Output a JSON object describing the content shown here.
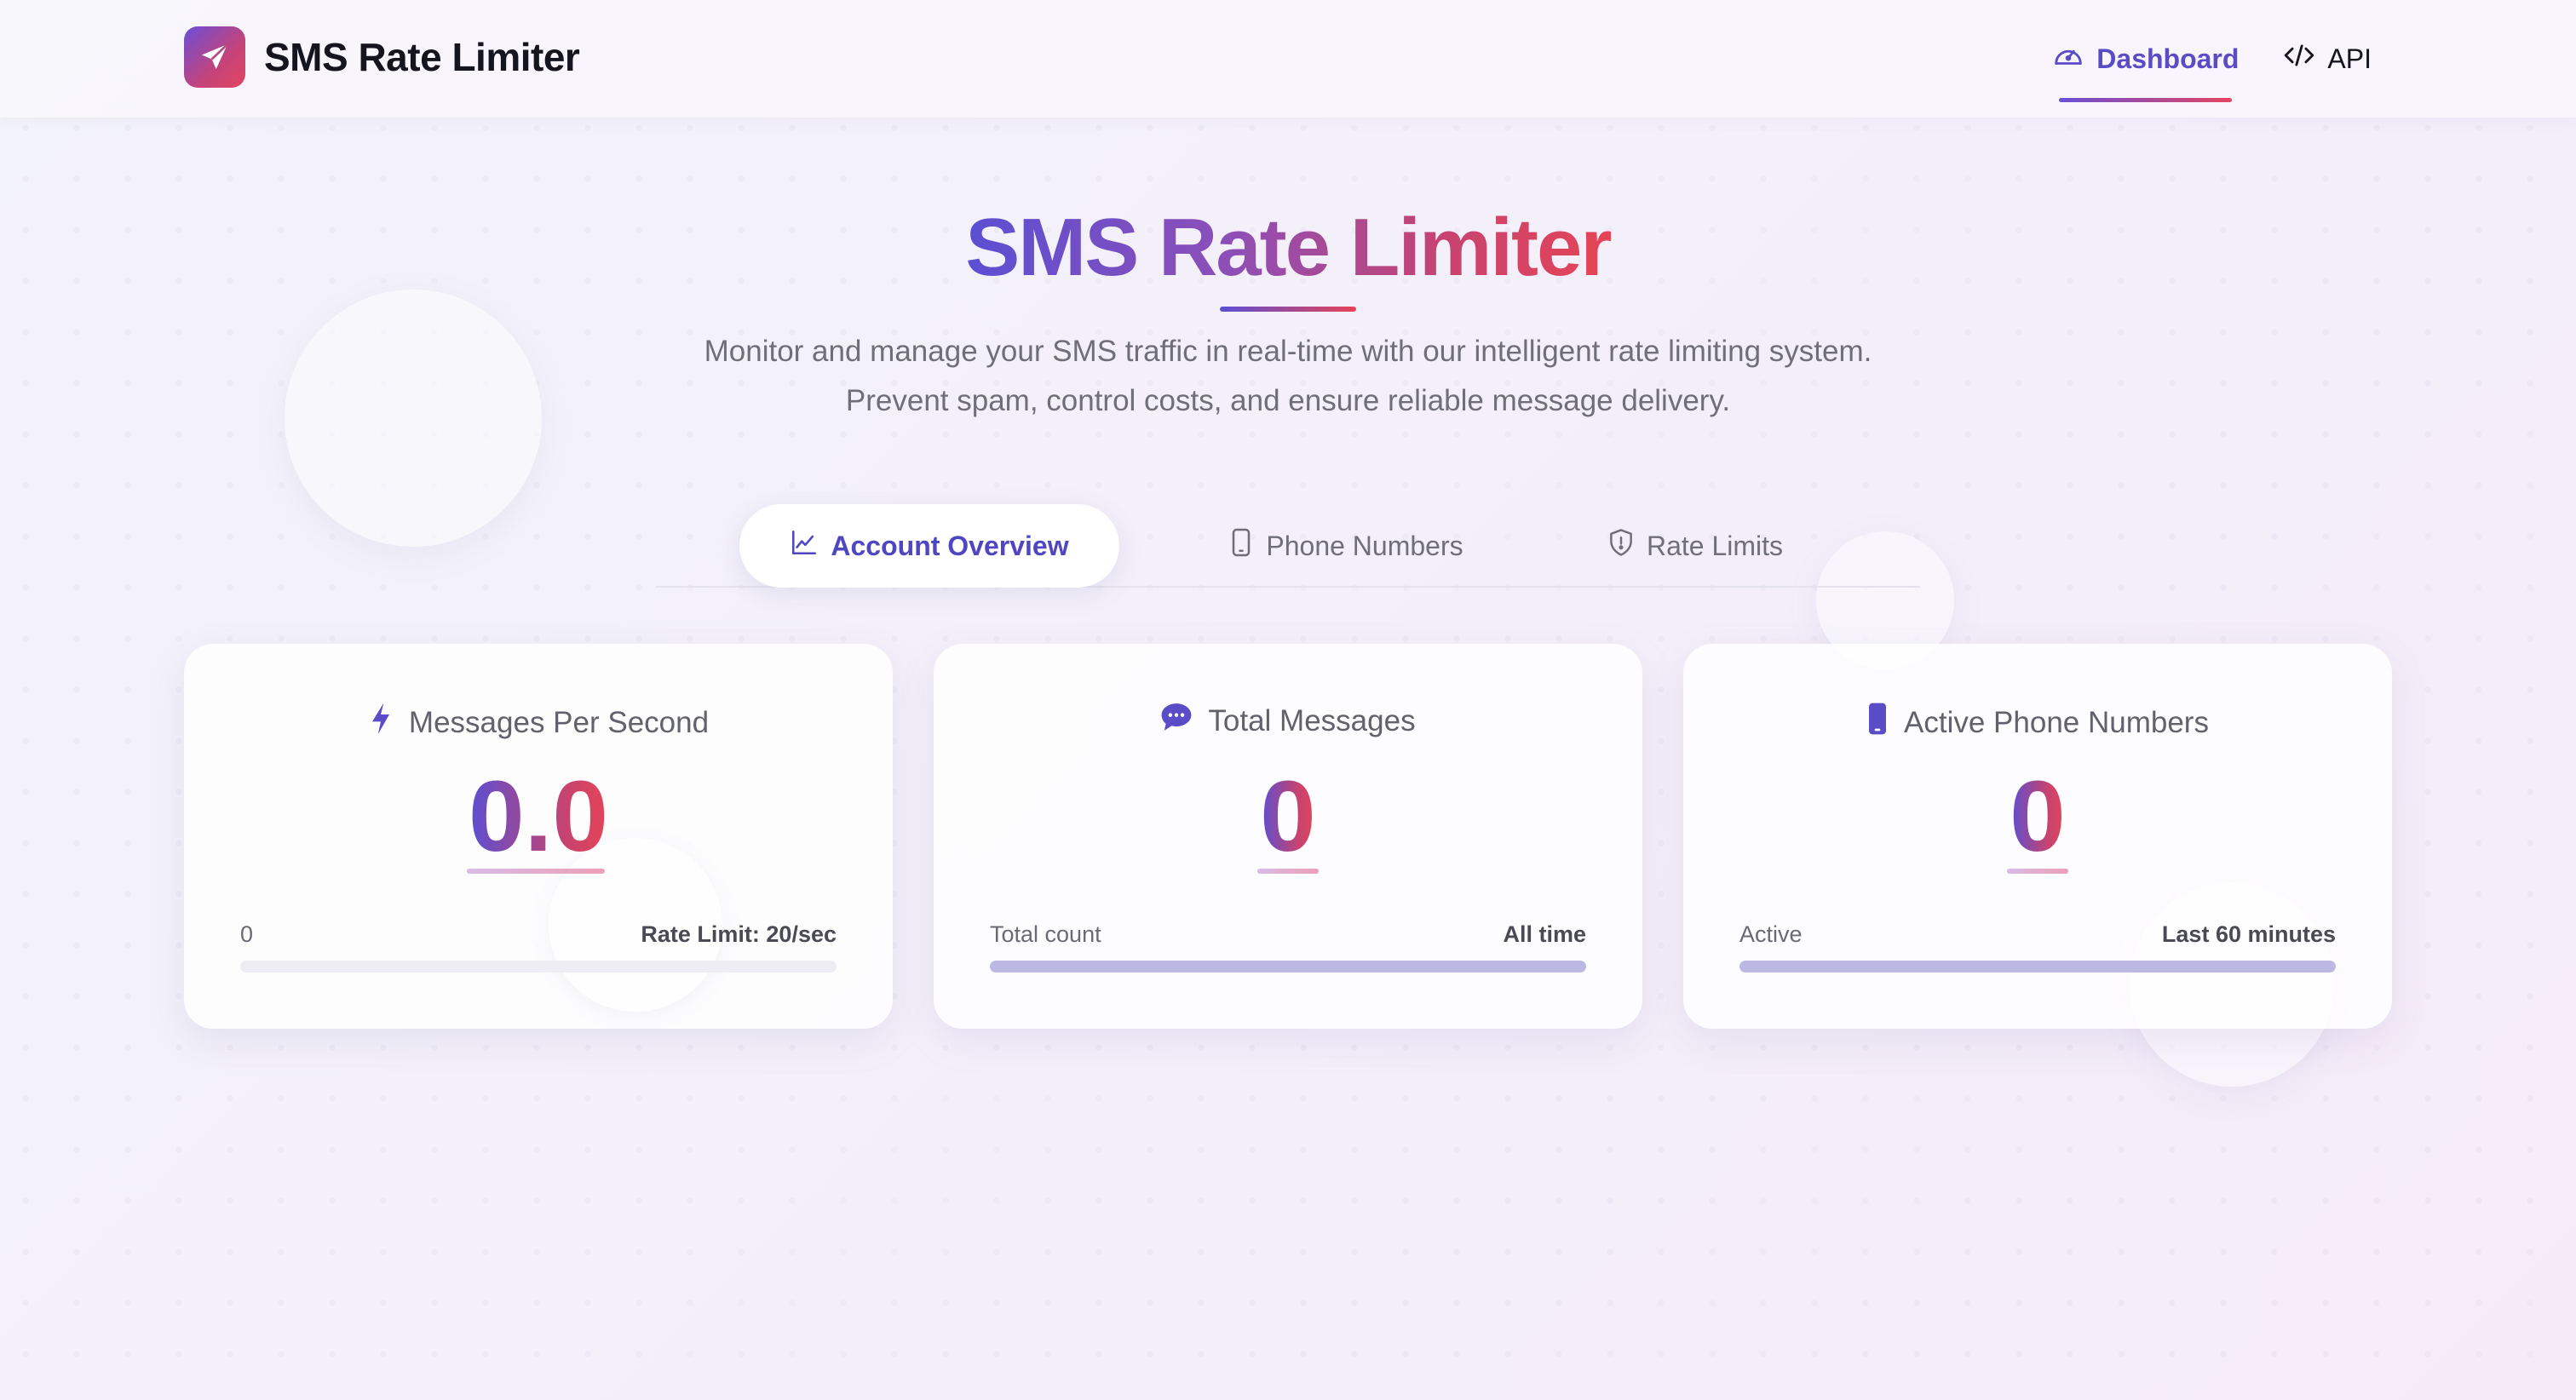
{
  "app": {
    "brand_name": "SMS Rate Limiter",
    "accent": "#5a4bc7",
    "gradient_start": "#5b4fd2",
    "gradient_end": "#e64456"
  },
  "nav": {
    "items": [
      {
        "label": "Dashboard",
        "icon": "speedometer-icon",
        "active": true
      },
      {
        "label": "API",
        "icon": "code-icon",
        "active": false
      }
    ]
  },
  "hero": {
    "title": "SMS Rate Limiter",
    "description": "Monitor and manage your SMS traffic in real-time with our intelligent rate limiting system. Prevent spam, control costs, and ensure reliable message delivery."
  },
  "tabs": [
    {
      "label": "Account Overview",
      "icon": "chart-line-icon",
      "active": true
    },
    {
      "label": "Phone Numbers",
      "icon": "phone-icon",
      "active": false
    },
    {
      "label": "Rate Limits",
      "icon": "shield-icon",
      "active": false
    }
  ],
  "cards": [
    {
      "title": "Messages Per Second",
      "icon": "bolt-icon",
      "value": "0.0",
      "meta_left": "0",
      "meta_right": "Rate Limit: 20/sec",
      "progress": 0
    },
    {
      "title": "Total Messages",
      "icon": "chat-bubble-icon",
      "value": "0",
      "meta_left": "Total count",
      "meta_right": "All time",
      "progress": 1
    },
    {
      "title": "Active Phone Numbers",
      "icon": "mobile-icon",
      "value": "0",
      "meta_left": "Active",
      "meta_right": "Last 60 minutes",
      "progress": 1
    }
  ]
}
